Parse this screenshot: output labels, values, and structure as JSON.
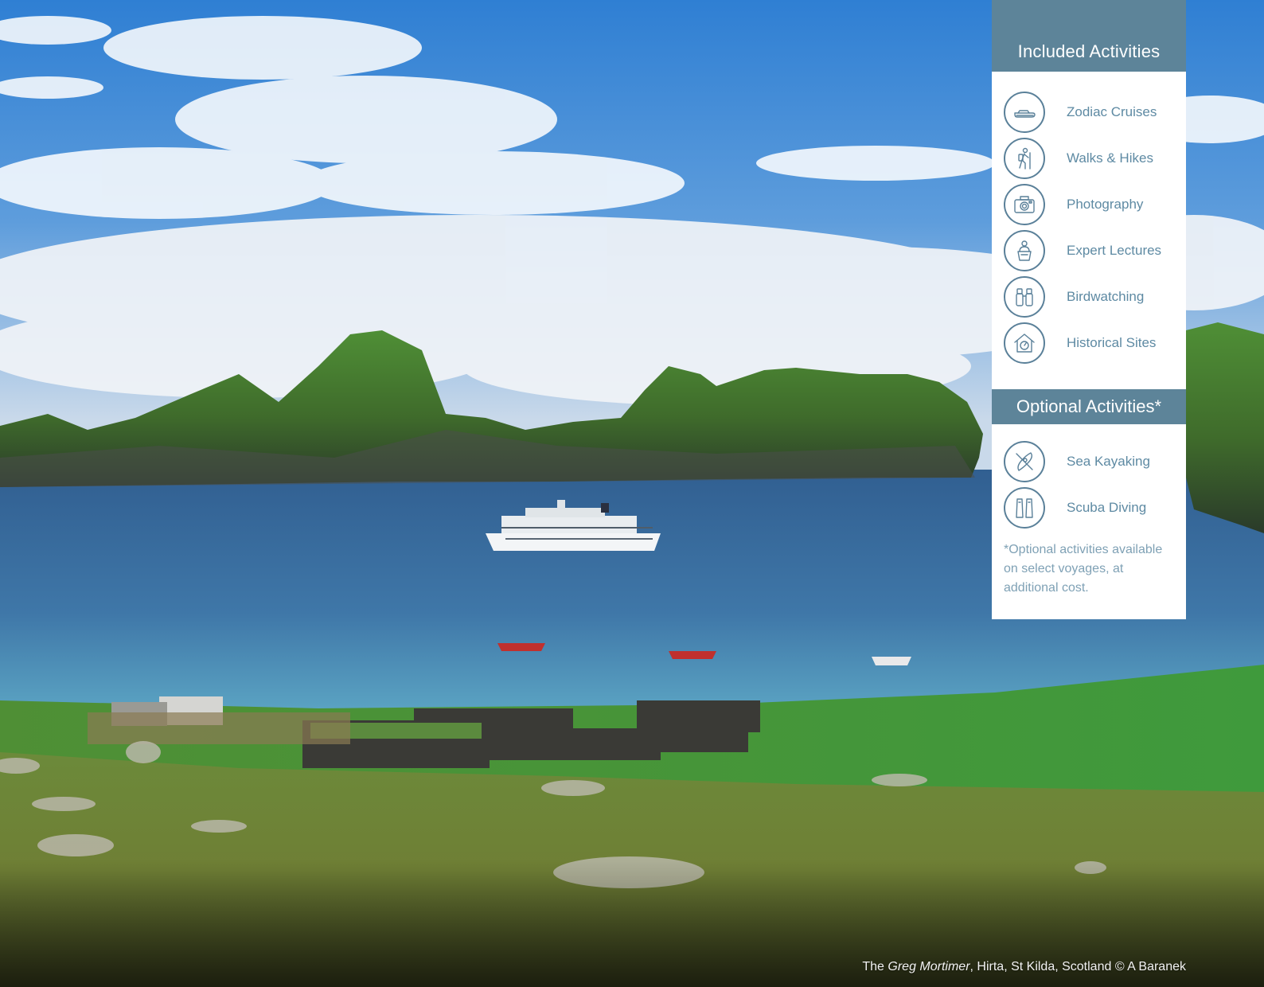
{
  "included": {
    "title": "Included Activities",
    "items": [
      {
        "label": "Zodiac Cruises",
        "icon": "zodiac-boat-icon"
      },
      {
        "label": "Walks & Hikes",
        "icon": "hiker-icon"
      },
      {
        "label": "Photography",
        "icon": "camera-icon"
      },
      {
        "label": "Expert Lectures",
        "icon": "lecturer-podium-icon"
      },
      {
        "label": "Birdwatching",
        "icon": "binoculars-icon"
      },
      {
        "label": "Historical Sites",
        "icon": "historic-house-icon"
      }
    ]
  },
  "optional": {
    "title": "Optional Activities*",
    "items": [
      {
        "label": "Sea Kayaking",
        "icon": "kayak-icon"
      },
      {
        "label": "Scuba Diving",
        "icon": "dive-fins-icon"
      }
    ],
    "footnote": "*Optional activities available on select voyages, at additional cost."
  },
  "caption": {
    "prefix": "The ",
    "ship_name": "Greg Mortimer",
    "suffix": ", Hirta, St Kilda, Scotland © A  Baranek"
  },
  "colors": {
    "panel_header": "#5d8499",
    "icon_stroke": "#5a8099",
    "label_text": "#5e8aa3",
    "footnote_text": "#7fa1b5"
  }
}
